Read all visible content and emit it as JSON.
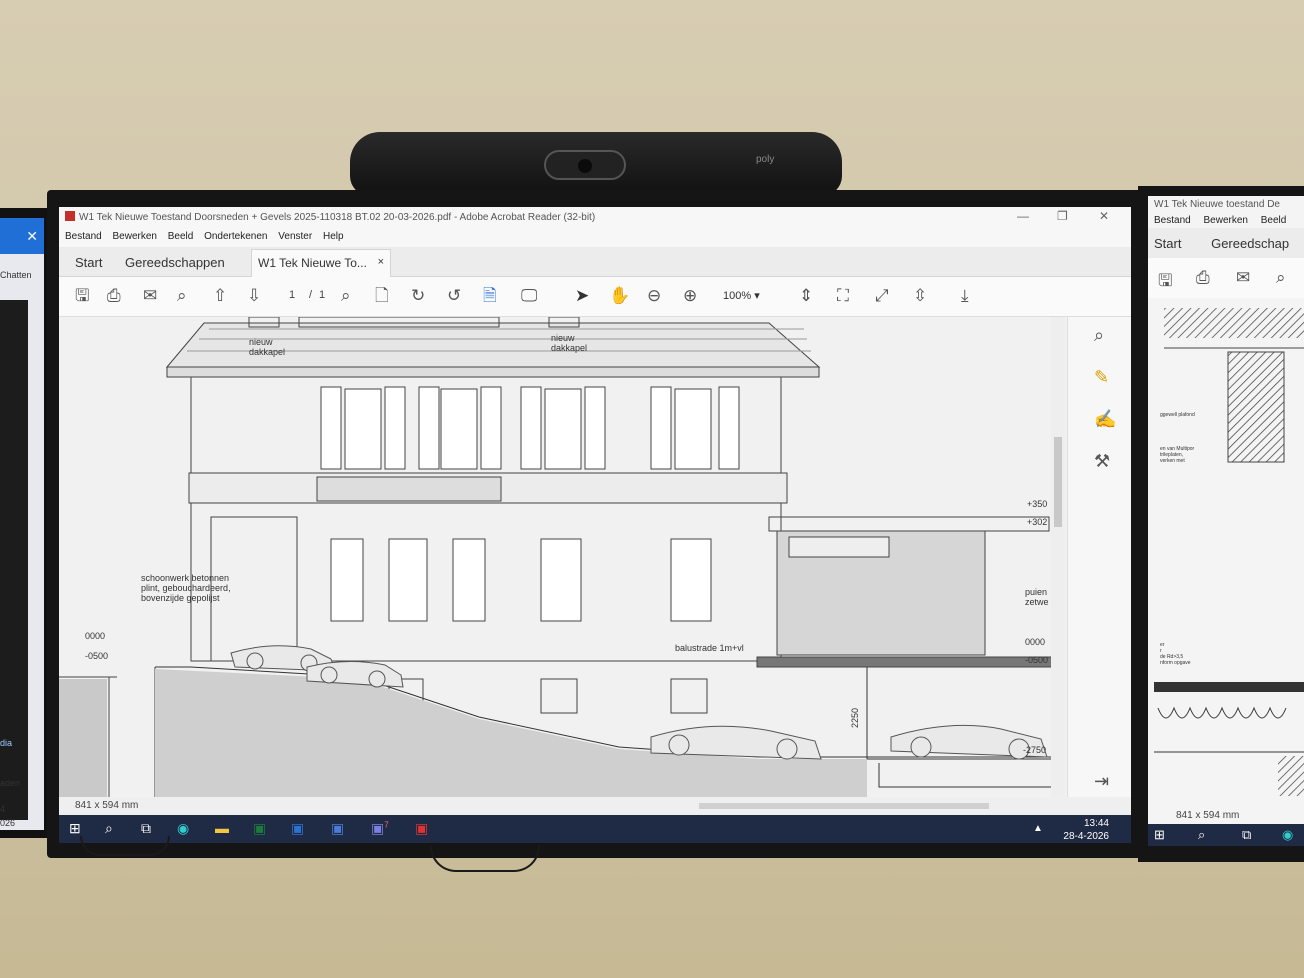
{
  "camera": {
    "brand": "poly"
  },
  "left_monitor": {
    "close": "✕",
    "chat_label": "Chatten",
    "media_label": "dia",
    "laden_label": "aden",
    "num_label": "4",
    "year_label": "026"
  },
  "window": {
    "title": "W1 Tek Nieuwe Toestand Doorsneden + Gevels 2025-110318 BT.02 20-03-2026.pdf - Adobe Acrobat Reader (32-bit)",
    "controls": {
      "minimize": "—",
      "restore": "❐",
      "close": "✕"
    },
    "menu": [
      "Bestand",
      "Bewerken",
      "Beeld",
      "Ondertekenen",
      "Venster",
      "Help"
    ],
    "tabs": {
      "start": "Start",
      "tools": "Gereedschappen",
      "doc": "W1 Tek Nieuwe To...",
      "doc_close": "×"
    },
    "toolbar": {
      "page_current": "1",
      "page_sep": "/",
      "page_total": "1",
      "zoom": "100%",
      "icons": [
        "save-icon",
        "print-icon",
        "mail-icon",
        "zoom-search-icon",
        "page-up-icon",
        "page-down-icon",
        "find-icon",
        "search-doc-icon",
        "rotate-cw-icon",
        "rotate-ccw-icon",
        "page-icon",
        "present-icon",
        "select-icon",
        "hand-icon",
        "zoom-out-icon",
        "zoom-in-icon",
        "fit-width-icon",
        "fit-page-icon",
        "fullscreen-icon",
        "scroll-mode-icon",
        "download-icon"
      ]
    },
    "status": {
      "size": "841 x 594 mm"
    }
  },
  "drawing": {
    "labels": {
      "dakkapel_left": "nieuw\ndakkapel",
      "dakkapel_right": "nieuw\ndakkapel",
      "schoonwerk": "schoonwerk betonnen\nplint, gebouchardeerd,\nbovenzijde gepolijst",
      "level_0000_left": "0000",
      "level_0500_left": "-0500",
      "balustrade": "balustrade 1m+vl",
      "level_350": "+350",
      "level_302": "+302",
      "puien": "puien\nzetwe",
      "level_0000_right": "0000",
      "level_0500_right": "-0500",
      "dim_2250": "2250",
      "level_2750": "-2750"
    }
  },
  "taskbar": {
    "time": "13:44",
    "date": "28-4-2026",
    "teams_badge": "7"
  },
  "right_monitor": {
    "title": "W1 Tek Nieuwe toestand De",
    "menu": [
      "Bestand",
      "Bewerken",
      "Beeld"
    ],
    "tabs": [
      "Start",
      "Gereedschap"
    ],
    "size": "841 x 594 mm",
    "notes": [
      "ggewell plafond",
      "en van Multipor\ntrileplaten,\nverken met",
      "er\nr\nde Rd>3,5\nnform opgave"
    ]
  }
}
